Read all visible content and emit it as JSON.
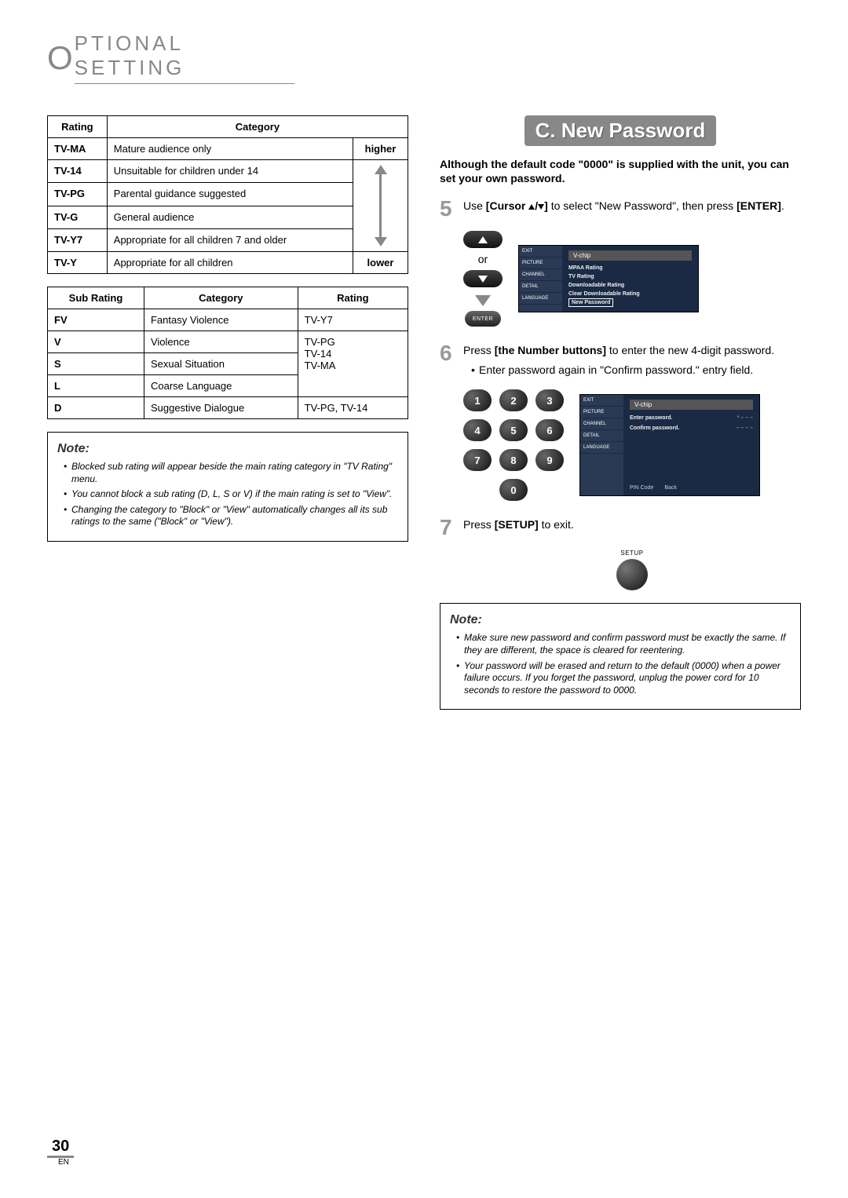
{
  "header": {
    "prefix": "O",
    "rest": "PTIONAL   SETTING"
  },
  "ratingTable": {
    "headers": {
      "rating": "Rating",
      "category": "Category"
    },
    "arrowTop": "higher",
    "arrowBottom": "lower",
    "rows": [
      {
        "rating": "TV-MA",
        "category": "Mature audience only"
      },
      {
        "rating": "TV-14",
        "category": "Unsuitable for children under 14"
      },
      {
        "rating": "TV-PG",
        "category": "Parental guidance suggested"
      },
      {
        "rating": "TV-G",
        "category": "General audience"
      },
      {
        "rating": "TV-Y7",
        "category": "Appropriate for all children 7 and older"
      },
      {
        "rating": "TV-Y",
        "category": "Appropriate for all children"
      }
    ]
  },
  "subRatingTable": {
    "headers": {
      "sub": "Sub Rating",
      "category": "Category",
      "rating": "Rating"
    },
    "rows": [
      {
        "sub": "FV",
        "category": "Fantasy Violence",
        "rating": "TV-Y7"
      },
      {
        "sub": "V",
        "category": "Violence",
        "rating": ""
      },
      {
        "sub": "S",
        "category": "Sexual Situation",
        "rating": "TV-PG\nTV-14\nTV-MA"
      },
      {
        "sub": "L",
        "category": "Coarse Language",
        "rating": ""
      },
      {
        "sub": "D",
        "category": "Suggestive Dialogue",
        "rating": "TV-PG, TV-14"
      }
    ],
    "groupRating": "TV-PG\nTV-14\nTV-MA"
  },
  "note1": {
    "title": "Note:",
    "items": [
      "Blocked sub rating will appear beside the main rating category in \"TV Rating\" menu.",
      "You cannot block a sub rating (D, L, S or V) if the main rating is set to \"View\".",
      "Changing the category to \"Block\" or \"View\" automatically changes all its sub ratings to the same (\"Block\" or \"View\")."
    ]
  },
  "sectionC": {
    "title": "C.  New Password",
    "intro": "Although the default code \"0000\" is supplied with the unit, you can set your own password.",
    "step5": {
      "num": "5",
      "pre": "Use ",
      "btnLabel": "[Cursor ",
      "post": "] ",
      "after": "to select \"New Password\", then press ",
      "enter": "[ENTER]",
      "period": "."
    },
    "or": "or",
    "enterLabel": "ENTER",
    "tvMenu1": {
      "title": "V-chip",
      "side": [
        "EXIT",
        "PICTURE",
        "CHANNEL",
        "DETAIL",
        "LANGUAGE"
      ],
      "items": [
        "MPAA Rating",
        "TV Rating",
        "Downloadable Rating",
        "Clear Downloadable Rating",
        "New Password"
      ],
      "selectedIndex": 4
    },
    "step6": {
      "num": "6",
      "pre": "Press ",
      "btnLabel": "[the Number buttons]",
      "after": " to enter the new 4-digit password.",
      "sub": "Enter password again in \"Confirm password.\" entry field."
    },
    "numpad": [
      "1",
      "2",
      "3",
      "4",
      "5",
      "6",
      "7",
      "8",
      "9",
      "0"
    ],
    "tvMenu2": {
      "title": "V-chip",
      "side": [
        "EXIT",
        "PICTURE",
        "CHANNEL",
        "DETAIL",
        "LANGUAGE"
      ],
      "rows": [
        {
          "label": "Enter password.",
          "value": "*  –  –  –"
        },
        {
          "label": "Confirm password.",
          "value": "–  –  –  –"
        }
      ],
      "footer": [
        "PIN Code",
        "Back"
      ]
    },
    "step7": {
      "num": "7",
      "pre": "Press ",
      "btnLabel": "[SETUP]",
      "after": " to exit."
    },
    "setupLabel": "SETUP"
  },
  "note2": {
    "title": "Note:",
    "items": [
      "Make sure new password and confirm password must be exactly the same. If they are different, the space is cleared for reentering.",
      "Your password will be erased and return to the default (0000) when a power failure occurs. If you forget the password, unplug the power cord for 10 seconds to restore the password to 0000."
    ]
  },
  "footer": {
    "page": "30",
    "lang": "EN"
  }
}
